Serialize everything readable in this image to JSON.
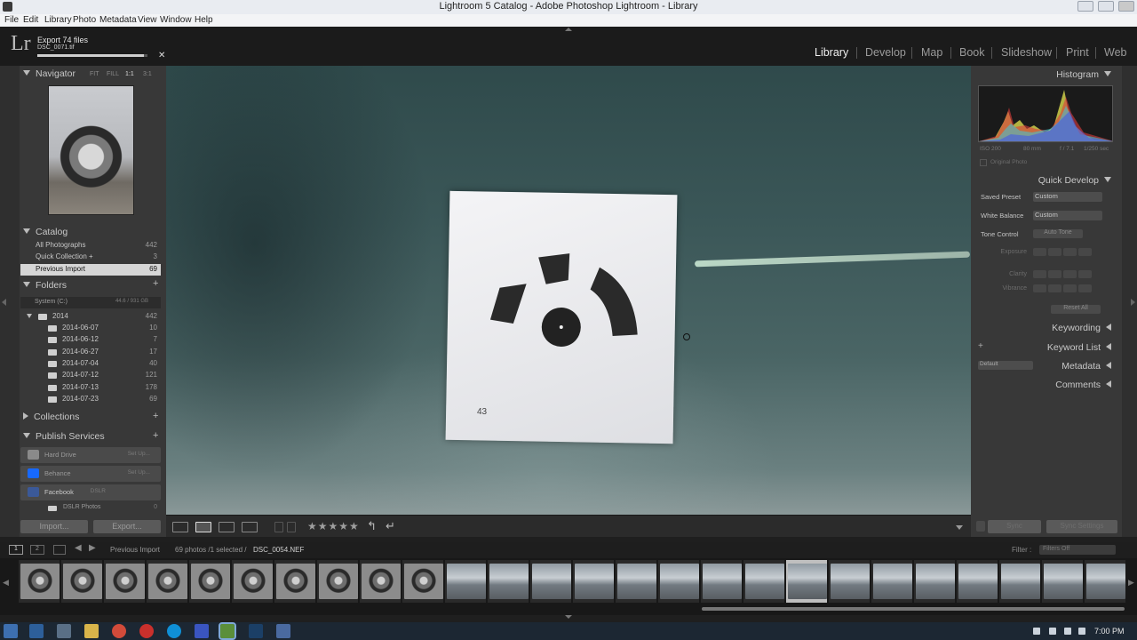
{
  "window": {
    "title": "Lightroom 5 Catalog - Adobe Photoshop Lightroom - Library"
  },
  "menu": [
    "File",
    "Edit",
    "Library",
    "Photo",
    "Metadata",
    "View",
    "Window",
    "Help"
  ],
  "identity": {
    "logo": "Lr",
    "export_title": "Export 74 files",
    "export_file": "DSC_0071.tif",
    "progress_fraction": 0.97,
    "close_glyph": "✕"
  },
  "modules": [
    "Library",
    "Develop",
    "Map",
    "Book",
    "Slideshow",
    "Print",
    "Web"
  ],
  "left": {
    "navigator": {
      "title": "Navigator",
      "modes": [
        "FIT",
        "FILL",
        "1:1",
        "3:1"
      ]
    },
    "catalog": {
      "title": "Catalog",
      "items": [
        {
          "label": "All Photographs",
          "count": "442"
        },
        {
          "label": "Quick Collection +",
          "count": "3"
        },
        {
          "label": "Previous Import",
          "count": "69"
        }
      ]
    },
    "folders": {
      "title": "Folders",
      "volume": {
        "label": "System (C:)",
        "stats": "44.6 / 931 GB"
      },
      "items": [
        {
          "label": "2014",
          "count": "442"
        },
        {
          "label": "2014-06-07",
          "count": "10"
        },
        {
          "label": "2014-06-12",
          "count": "7"
        },
        {
          "label": "2014-06-27",
          "count": "17"
        },
        {
          "label": "2014-07-04",
          "count": "40"
        },
        {
          "label": "2014-07-12",
          "count": "121"
        },
        {
          "label": "2014-07-13",
          "count": "178"
        },
        {
          "label": "2014-07-23",
          "count": "69"
        }
      ]
    },
    "collections": {
      "title": "Collections"
    },
    "publish": {
      "title": "Publish Services",
      "services": [
        {
          "label": "Hard Drive",
          "action": "Set Up...",
          "color": "#8a8a8a"
        },
        {
          "label": "Behance",
          "action": "Set Up...",
          "color": "#1769ff"
        },
        {
          "label": "Facebook",
          "action": "DSLR",
          "color": "#3b5998"
        }
      ],
      "sub_item": {
        "label": "DSLR Photos",
        "count": "0"
      }
    },
    "import_button": "Import...",
    "export_button": "Export..."
  },
  "main": {
    "target_number": "43",
    "stars": "★★★★★"
  },
  "right": {
    "histogram": {
      "title": "Histogram",
      "iso": "ISO 200",
      "focal": "80 mm",
      "aperture": "f / 7.1",
      "shutter": "1/250 sec",
      "original_photo": "Original Photo"
    },
    "quick_develop": {
      "title": "Quick Develop",
      "saved_preset_label": "Saved Preset",
      "saved_preset_value": "Custom",
      "white_balance_label": "White Balance",
      "white_balance_value": "Custom",
      "tone_control_label": "Tone Control",
      "auto_tone": "Auto Tone",
      "exposure": "Exposure",
      "clarity": "Clarity",
      "vibrance": "Vibrance",
      "reset_all": "Reset All"
    },
    "keywording": "Keywording",
    "keyword_list": "Keyword List",
    "metadata": "Metadata",
    "metadata_preset": "Default",
    "comments": "Comments",
    "sync": "Sync",
    "sync_settings": "Sync Settings"
  },
  "filmbar": {
    "source": "Previous Import",
    "summary": "69 photos /1 selected /",
    "filename": "DSC_0054.NEF",
    "filter_label": "Filter :",
    "filter_value": "Filters Off",
    "page_1": "1",
    "page_2": "2"
  },
  "taskbar": {
    "time": "7:00 PM"
  }
}
